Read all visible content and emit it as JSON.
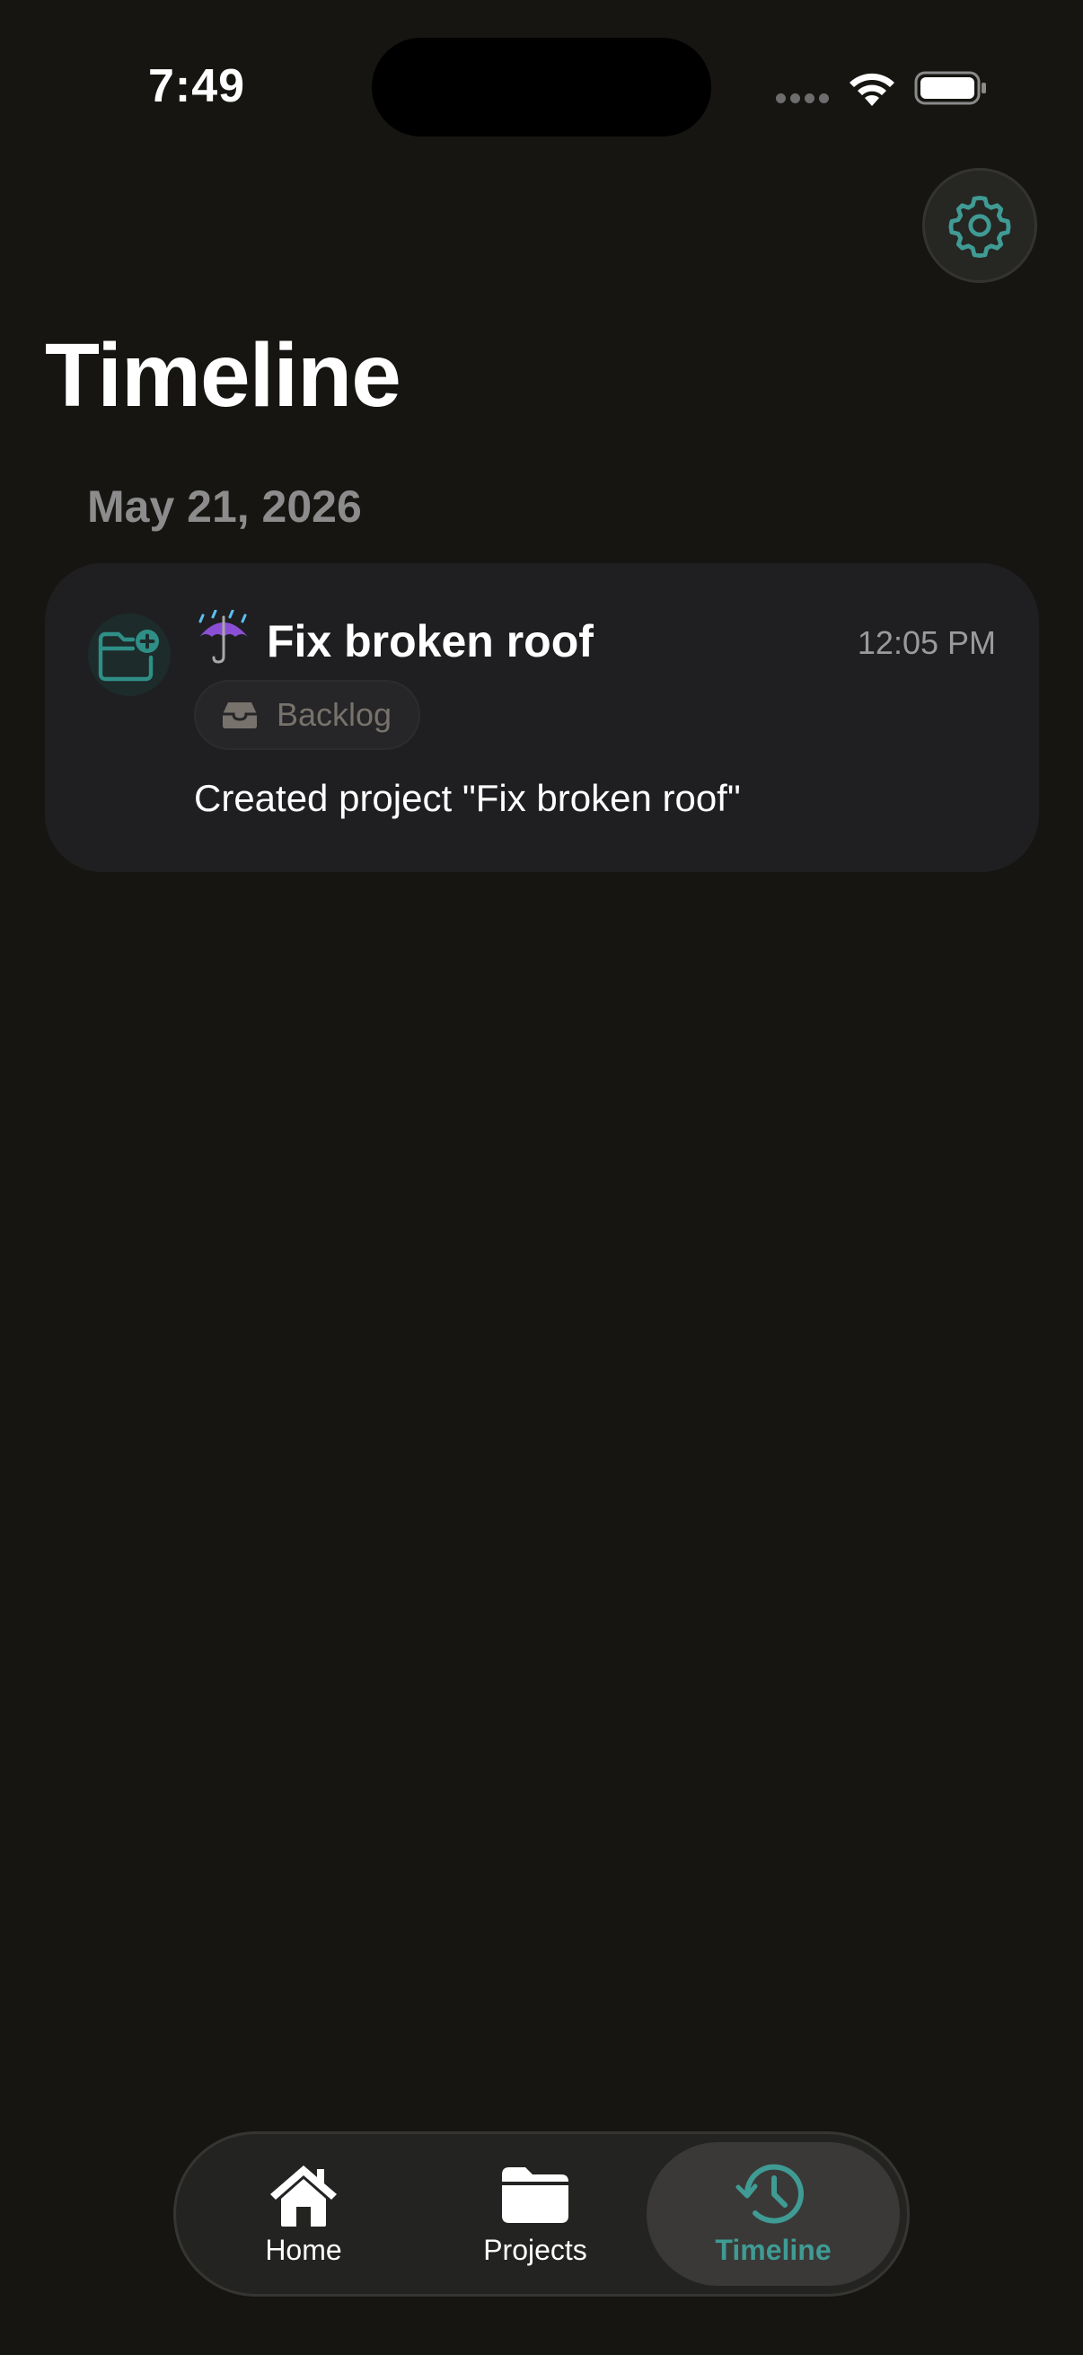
{
  "status_bar": {
    "time": "7:49"
  },
  "header": {
    "title": "Timeline",
    "settings_icon": "gear-icon"
  },
  "timeline": {
    "sections": [
      {
        "date": "May 21, 2026",
        "entries": [
          {
            "icon": "folder-plus-icon",
            "emoji": "umbrella-with-rain-icon",
            "title": "Fix broken roof",
            "time": "12:05 PM",
            "status": "Backlog",
            "status_icon": "inbox-tray-icon",
            "description": "Created project \"Fix broken roof\""
          }
        ]
      }
    ]
  },
  "tab_bar": {
    "tabs": [
      {
        "label": "Home",
        "icon": "house-icon",
        "selected": false
      },
      {
        "label": "Projects",
        "icon": "folder-icon",
        "selected": false
      },
      {
        "label": "Timeline",
        "icon": "clock-history-icon",
        "selected": true
      }
    ]
  },
  "colors": {
    "background": "#161512",
    "card": "#1f1f21",
    "accent": "#3f9b94",
    "muted_text": "#8c8c8c",
    "badge_text": "#77726b"
  }
}
